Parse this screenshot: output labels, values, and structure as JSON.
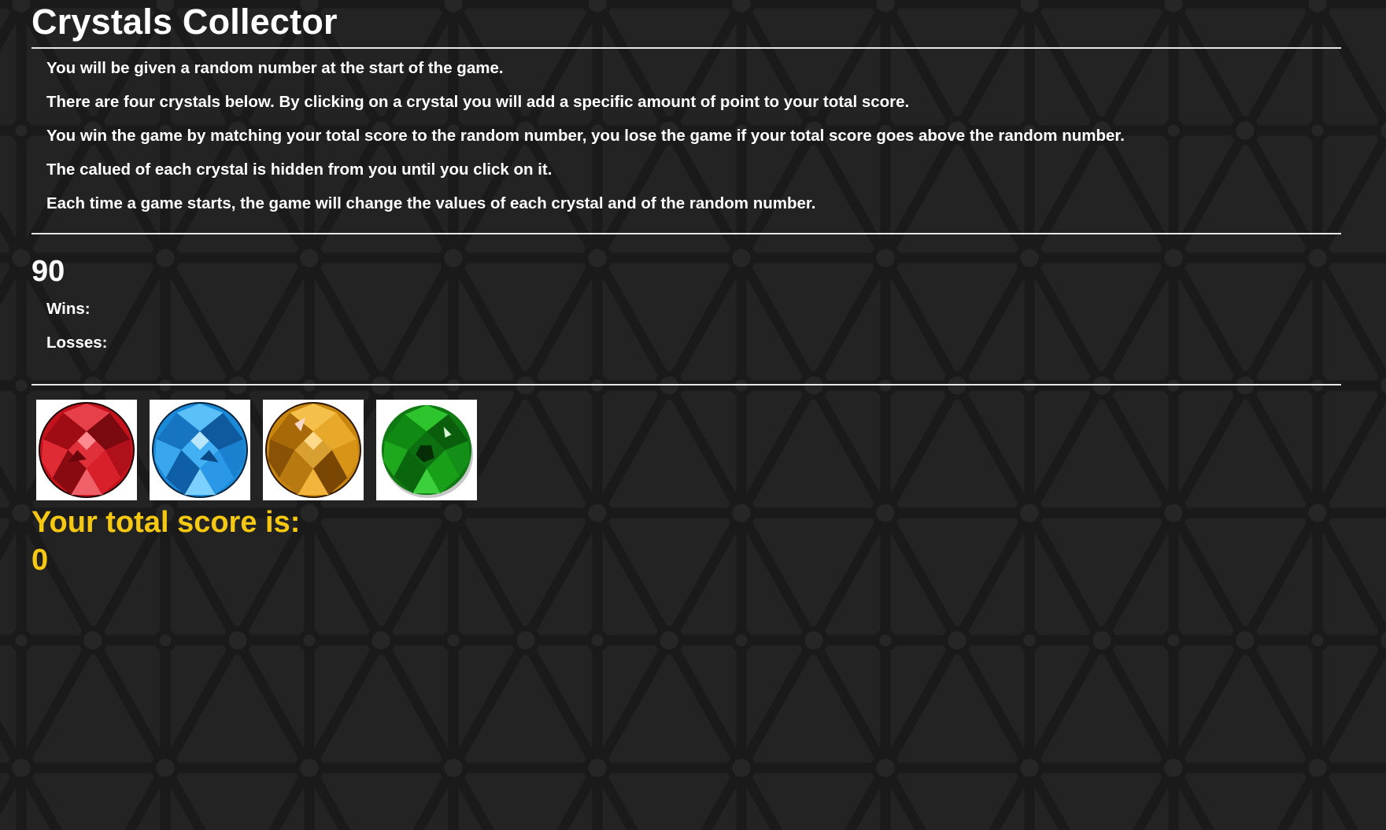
{
  "title": "Crystals Collector",
  "instructions": [
    "You will be given a random number at the start of the game.",
    "There are four crystals below. By clicking on a crystal you will add a specific amount of point to your total score.",
    "You win the game by matching your total score to the random number, you lose the game if your total score goes above the random number.",
    "The calued of each crystal is hidden from you until you click on it.",
    "Each time a game starts, the game will change the values of each crystal and of the random number."
  ],
  "random_number": "90",
  "wins_label": "Wins:",
  "losses_label": "Losses:",
  "crystals": [
    {
      "icon": "red-crystal-icon",
      "color": "#d3121c"
    },
    {
      "icon": "blue-crystal-icon",
      "color": "#1d8ee3"
    },
    {
      "icon": "orange-crystal-icon",
      "color": "#d99411"
    },
    {
      "icon": "green-crystal-icon",
      "color": "#14a814"
    }
  ],
  "score_label": "Your total score is:",
  "score_value": "0",
  "colors": {
    "background": "#232323",
    "text": "#ffffff",
    "score": "#f6c812"
  }
}
